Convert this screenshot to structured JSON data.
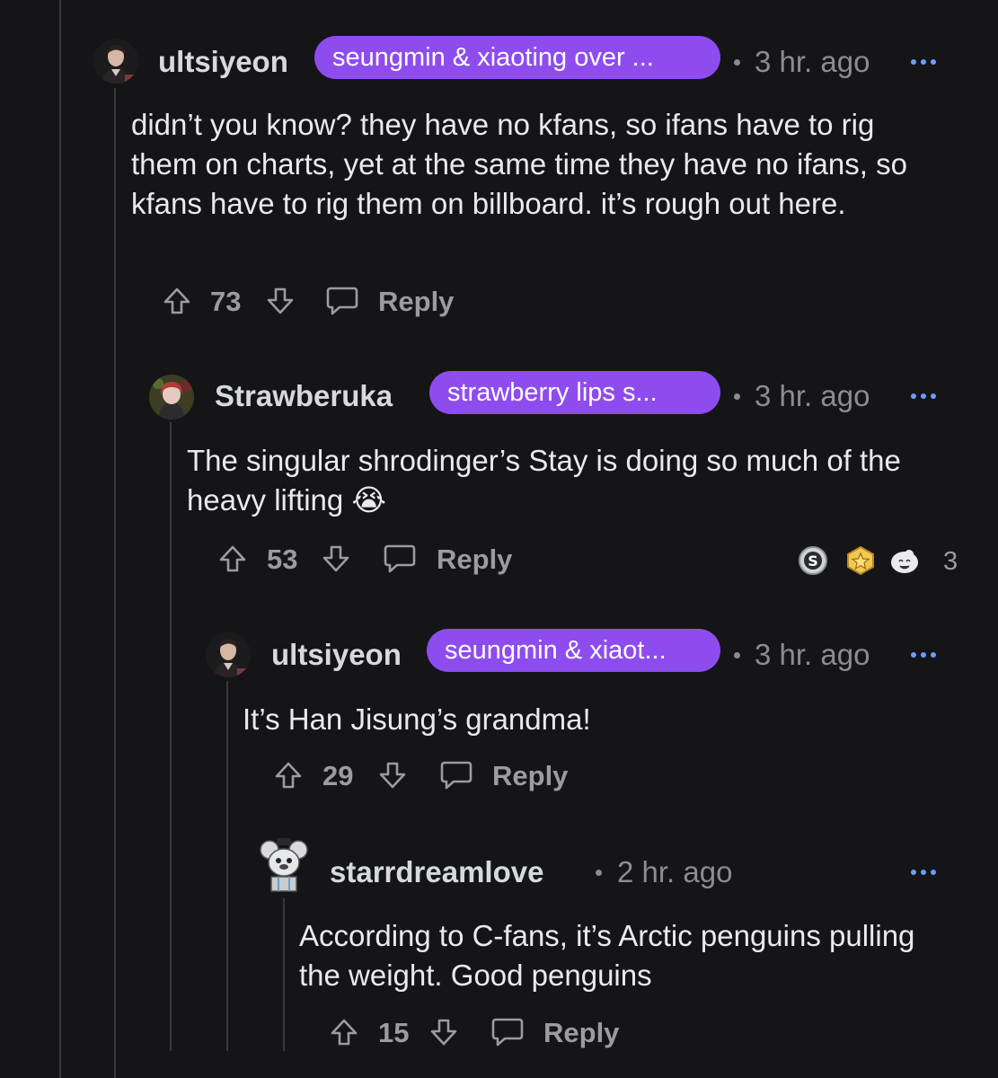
{
  "comments": [
    {
      "username": "ultsiyeon",
      "flair": "seungmin & xiaoting over ...",
      "time": "3 hr. ago",
      "body": "didn’t you know? they have no kfans, so ifans have to rig them on charts, yet at the same time they have no ifans, so kfans have to rig them on billboard. it’s rough out here.",
      "score": "73",
      "reply": "Reply"
    },
    {
      "username": "Strawberuka",
      "flair": "strawberry lips s...",
      "time": "3 hr. ago",
      "body": "The singular shrodinger’s Stay is doing so much of the heavy lifting 😭",
      "score": "53",
      "reply": "Reply",
      "awards_count": "3"
    },
    {
      "username": "ultsiyeon",
      "flair": "seungmin & xiaot...",
      "time": "3 hr. ago",
      "body": "It’s Han Jisung’s grandma!",
      "score": "29",
      "reply": "Reply"
    },
    {
      "username": "starrdreamlove",
      "time": "2 hr. ago",
      "body": "According to C-fans, it’s Arctic penguins pulling the weight. Good penguins",
      "score": "15",
      "reply": "Reply"
    }
  ],
  "colors": {
    "background": "#151518",
    "flair": "#8e4cef",
    "more_dots": "#6f9cff",
    "muted": "#9b9ba0"
  }
}
